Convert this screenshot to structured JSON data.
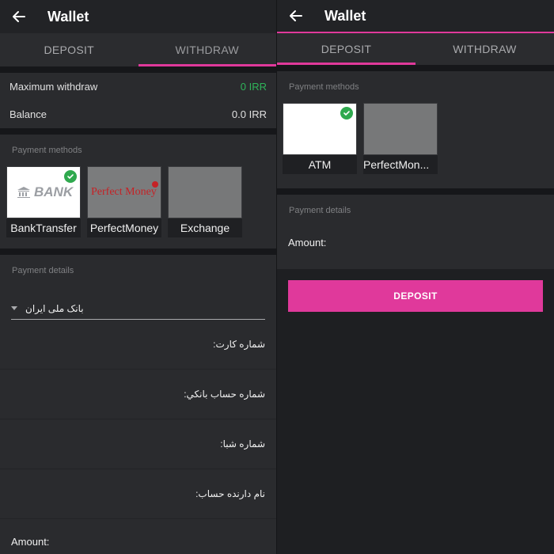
{
  "left": {
    "app_title": "Wallet",
    "tabs": [
      {
        "label": "DEPOSIT",
        "active": false
      },
      {
        "label": "WITHDRAW",
        "active": true
      }
    ],
    "info": {
      "max_withdraw_label": "Maximum withdraw",
      "max_withdraw_value": "0 IRR",
      "balance_label": "Balance",
      "balance_value": "0.0 IRR"
    },
    "payment_methods_label": "Payment methods",
    "methods": [
      {
        "label": "BankTransfer",
        "logo_text": "BANK",
        "selected": true
      },
      {
        "label": "PerfectMoney",
        "logo_text": "Perfect Money",
        "selected": false
      },
      {
        "label": "Exchange",
        "selected": false
      }
    ],
    "payment_details_label": "Payment details",
    "bank_select_value": "بانک ملی ایران",
    "fields": [
      "شماره کارت:",
      "شماره حساب بانکي:",
      "شماره شبا:",
      "نام دارنده حساب:"
    ],
    "amount_label": "Amount:"
  },
  "right": {
    "app_title": "Wallet",
    "tabs": [
      {
        "label": "DEPOSIT",
        "active": true
      },
      {
        "label": "WITHDRAW",
        "active": false
      }
    ],
    "payment_methods_label": "Payment methods",
    "methods": [
      {
        "label": "ATM",
        "selected": true
      },
      {
        "label": "PerfectMon...",
        "selected": false
      }
    ],
    "payment_details_label": "Payment details",
    "amount_label": "Amount:",
    "deposit_button": "DEPOSIT"
  },
  "colors": {
    "accent": "#e0399b",
    "success": "#2fb45a",
    "background": "#1e1f22",
    "card": "#2a2b2e"
  },
  "icons": [
    "back-arrow-icon",
    "check-circle-icon",
    "bank-building-icon",
    "dropdown-caret-icon"
  ]
}
